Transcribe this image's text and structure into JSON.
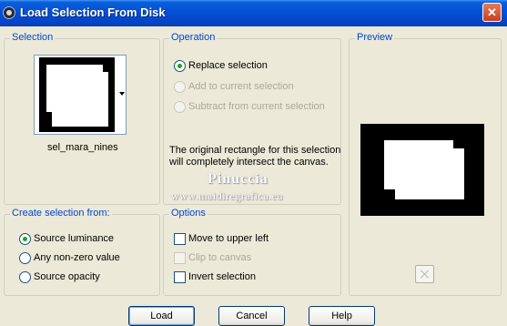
{
  "window": {
    "title": "Load Selection From Disk",
    "close_label": "✕"
  },
  "selection": {
    "legend": "Selection",
    "file_name": "sel_mara_nines"
  },
  "operation": {
    "legend": "Operation",
    "options": [
      {
        "label": "Replace selection",
        "selected": true,
        "enabled": true
      },
      {
        "label": "Add to current selection",
        "selected": false,
        "enabled": false
      },
      {
        "label": "Subtract from current selection",
        "selected": false,
        "enabled": false
      }
    ],
    "description": "The original rectangle for this selection will completely intersect the canvas."
  },
  "preview": {
    "legend": "Preview"
  },
  "create_from": {
    "legend": "Create selection from:",
    "options": [
      {
        "label": "Source luminance",
        "selected": true
      },
      {
        "label": "Any non-zero value",
        "selected": false
      },
      {
        "label": "Source opacity",
        "selected": false
      }
    ]
  },
  "options": {
    "legend": "Options",
    "items": [
      {
        "label": "Move to upper left",
        "checked": false,
        "enabled": true
      },
      {
        "label": "Clip to canvas",
        "checked": false,
        "enabled": false
      },
      {
        "label": "Invert selection",
        "checked": false,
        "enabled": true
      }
    ]
  },
  "watermark": {
    "line1": "Pinuccia",
    "line2": "www.maidiregrafica.eu"
  },
  "buttons": {
    "load": "Load",
    "cancel": "Cancel",
    "help": "Help"
  }
}
